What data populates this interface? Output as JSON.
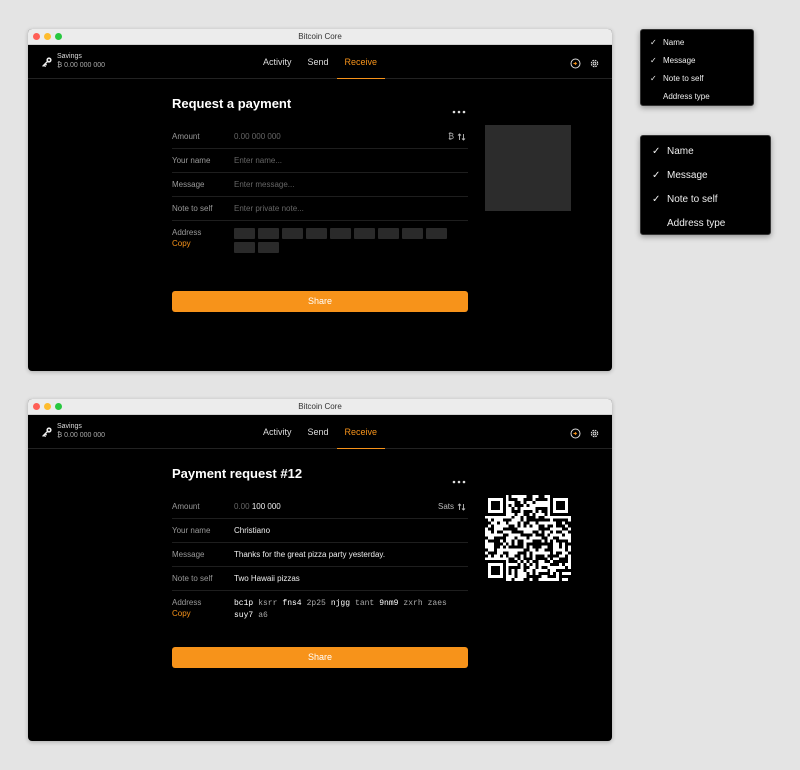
{
  "app_title": "Bitcoin Core",
  "wallet": {
    "name": "Savings",
    "balance": "₿ 0.00 000 000"
  },
  "nav": {
    "tabs": [
      "Activity",
      "Send",
      "Receive"
    ],
    "active": "Receive"
  },
  "accent_color": "#f7931a",
  "request_form": {
    "title": "Request a payment",
    "amount_label": "Amount",
    "amount_placeholder": "0.00 000 000",
    "amount_unit": "₿",
    "name_label": "Your name",
    "name_placeholder": "Enter name...",
    "message_label": "Message",
    "message_placeholder": "Enter message...",
    "note_label": "Note to self",
    "note_placeholder": "Enter private note...",
    "address_label": "Address",
    "copy_label": "Copy",
    "share_label": "Share"
  },
  "payment_request": {
    "title": "Payment request #12",
    "amount_label": "Amount",
    "amount_prefix": "0.00",
    "amount_value": "100 000",
    "amount_unit": "Sats",
    "name_label": "Your name",
    "name_value": "Christiano",
    "message_label": "Message",
    "message_value": "Thanks for the great pizza party yesterday.",
    "note_label": "Note to self",
    "note_value": "Two Hawaii pizzas",
    "address_label": "Address",
    "copy_label": "Copy",
    "address_chunks": [
      "bc1p",
      "ksrr",
      "fns4",
      "2p25",
      "njgg",
      "tant",
      "9nm9",
      "zxrh",
      "zaes",
      "suy7",
      "a6"
    ],
    "share_label": "Share"
  },
  "menu": {
    "items": [
      {
        "label": "Name",
        "checked": true
      },
      {
        "label": "Message",
        "checked": true
      },
      {
        "label": "Note to self",
        "checked": true
      },
      {
        "label": "Address type",
        "checked": false
      }
    ]
  },
  "icons": [
    "key-icon",
    "sync-icon",
    "gear-icon",
    "more-icon",
    "swap-arrows-icon",
    "checkmark-icon"
  ]
}
